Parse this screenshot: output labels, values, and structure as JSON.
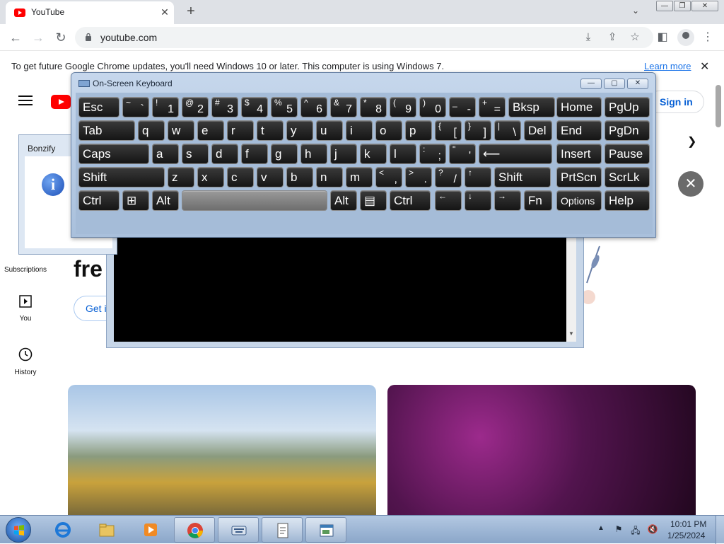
{
  "browser": {
    "tab_title": "YouTube",
    "tab_close": "✕",
    "new_tab": "+",
    "url": "youtube.com",
    "window_buttons": [
      "—",
      "❐",
      "✕"
    ]
  },
  "infobar": {
    "message": "To get future Google Chrome updates, you'll need Windows 10 or later. This computer is using Windows 7.",
    "link": "Learn more",
    "close": "✕"
  },
  "youtube": {
    "signin": "Sign in",
    "sidebar": [
      {
        "label": "Subscriptions"
      },
      {
        "label": "You"
      },
      {
        "label": "History"
      }
    ],
    "promo_text": "fre",
    "promo_button": "Get i"
  },
  "bonzify": {
    "title": "Bonzify",
    "icon_glyph": "i"
  },
  "osk": {
    "title": "On-Screen Keyboard",
    "controls": [
      "—",
      "▢",
      "✕"
    ],
    "rows": [
      [
        {
          "label": "Esc"
        },
        {
          "top": "~",
          "bot": "`"
        },
        {
          "top": "!",
          "bot": "1"
        },
        {
          "top": "@",
          "bot": "2"
        },
        {
          "top": "#",
          "bot": "3"
        },
        {
          "top": "$",
          "bot": "4"
        },
        {
          "top": "%",
          "bot": "5"
        },
        {
          "top": "^",
          "bot": "6"
        },
        {
          "top": "&",
          "bot": "7"
        },
        {
          "top": "*",
          "bot": "8"
        },
        {
          "top": "(",
          "bot": "9"
        },
        {
          "top": ")",
          "bot": "0"
        },
        {
          "top": "_",
          "bot": "-"
        },
        {
          "top": "+",
          "bot": "="
        },
        {
          "label": "Bksp"
        },
        {
          "label": "Home"
        },
        {
          "label": "PgUp"
        }
      ],
      [
        {
          "label": "Tab"
        },
        {
          "label": "q"
        },
        {
          "label": "w"
        },
        {
          "label": "e"
        },
        {
          "label": "r"
        },
        {
          "label": "t"
        },
        {
          "label": "y"
        },
        {
          "label": "u"
        },
        {
          "label": "i"
        },
        {
          "label": "o"
        },
        {
          "label": "p"
        },
        {
          "top": "{",
          "bot": "["
        },
        {
          "top": "}",
          "bot": "]"
        },
        {
          "top": "|",
          "bot": "\\"
        },
        {
          "label": "Del"
        },
        {
          "label": "End"
        },
        {
          "label": "PgDn"
        }
      ],
      [
        {
          "label": "Caps"
        },
        {
          "label": "a"
        },
        {
          "label": "s"
        },
        {
          "label": "d"
        },
        {
          "label": "f"
        },
        {
          "label": "g"
        },
        {
          "label": "h"
        },
        {
          "label": "j"
        },
        {
          "label": "k"
        },
        {
          "label": "l"
        },
        {
          "top": ":",
          "bot": ";"
        },
        {
          "top": "\"",
          "bot": "'"
        },
        {
          "label": "⟵"
        },
        {
          "label": "Insert"
        },
        {
          "label": "Pause"
        }
      ],
      [
        {
          "label": "Shift"
        },
        {
          "label": "z"
        },
        {
          "label": "x"
        },
        {
          "label": "c"
        },
        {
          "label": "v"
        },
        {
          "label": "b"
        },
        {
          "label": "n"
        },
        {
          "label": "m"
        },
        {
          "top": "<",
          "bot": ","
        },
        {
          "top": ">",
          "bot": "."
        },
        {
          "top": "?",
          "bot": "/"
        },
        {
          "top": "↑",
          "bot": ""
        },
        {
          "label": "Shift"
        },
        {
          "label": "PrtScn"
        },
        {
          "label": "ScrLk"
        }
      ],
      [
        {
          "label": "Ctrl"
        },
        {
          "label": "⊞"
        },
        {
          "label": "Alt"
        },
        {
          "label": ""
        },
        {
          "label": "Alt"
        },
        {
          "label": "▤"
        },
        {
          "label": "Ctrl"
        },
        {
          "top": "←",
          "bot": ""
        },
        {
          "top": "↓",
          "bot": ""
        },
        {
          "top": "→",
          "bot": ""
        },
        {
          "label": "Fn"
        },
        {
          "label": "Options"
        },
        {
          "label": "Help"
        }
      ]
    ]
  },
  "taskbar": {
    "apps": [
      "Internet Explorer",
      "Windows Explorer",
      "Windows Media Player",
      "Google Chrome",
      "On-Screen Keyboard",
      "Notepad",
      "Window"
    ],
    "time": "10:01 PM",
    "date": "1/25/2024"
  }
}
